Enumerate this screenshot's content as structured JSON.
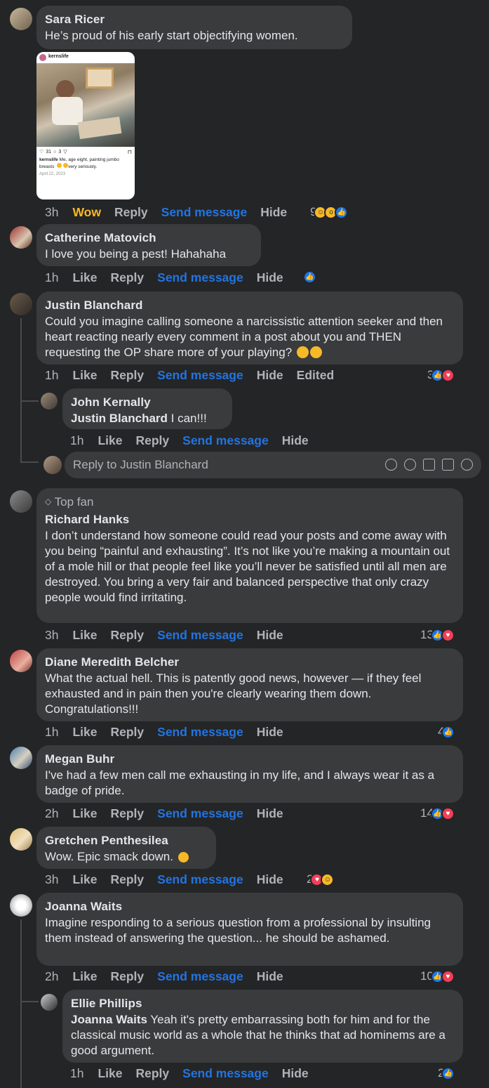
{
  "actions": {
    "like": "Like",
    "reply": "Reply",
    "send": "Send message",
    "hide": "Hide",
    "edited": "Edited",
    "wow": "Wow"
  },
  "comments": [
    {
      "name": "Sara Ricer",
      "text": "He’s proud of his early start objectifying women.",
      "time": "3h",
      "reaction_count": "9"
    },
    {
      "name": "Catherine Matovich",
      "text": "I love you being a pest! Hahahaha",
      "time": "1h"
    },
    {
      "name": "Justin Blanchard",
      "text": "Could you imagine calling someone a narcissistic attention seeker and then heart reacting nearly every comment in a post about you and THEN requesting the OP share more of your playing?",
      "time": "1h",
      "reaction_count": "3"
    },
    {
      "name": "Richard Hanks",
      "badge": "Top fan",
      "text": "I don’t understand how someone could read your posts and come away with you being “painful and exhausting”. It’s not like you’re making a mountain out of a mole hill or that people feel like you’ll never be satisfied until all men are destroyed. You bring a very fair and balanced perspective that only crazy people would find irritating.",
      "time": "3h",
      "reaction_count": "13"
    },
    {
      "name": "Diane Meredith Belcher",
      "text": "What the actual hell. This is patently good news, however — if they feel exhausted and in pain then you're clearly wearing them down. Congratulations!!!",
      "time": "1h",
      "reaction_count": "4"
    },
    {
      "name": "Megan Buhr",
      "text": "I've had a few men call me exhausting in my life, and I always wear it as a badge of pride.",
      "time": "2h",
      "reaction_count": "14"
    },
    {
      "name": "Gretchen Penthesilea",
      "text": "Wow. Epic smack down.",
      "time": "3h",
      "reaction_count": "2"
    },
    {
      "name": "Joanna Waits",
      "text": "Imagine responding to a serious question from a professional by insulting them instead of answering the question... he should be ashamed.",
      "time": "2h",
      "reaction_count": "10"
    }
  ],
  "replies": [
    {
      "name": "John Kernally",
      "mention": "Justin Blanchard",
      "text": " I can!!!",
      "time": "1h"
    },
    {
      "name": "Ellie Phillips",
      "mention": "Joanna Waits",
      "text": " Yeah it's pretty embarrassing both for him and for the classical music world as a whole that he thinks that ad hominems are a good argument.",
      "time": "1h",
      "reaction_count": "2"
    }
  ],
  "reply_box": {
    "placeholder": "Reply to Justin Blanchard"
  },
  "attachment": {
    "username": "kernslife",
    "likes": "31",
    "comments": "3",
    "caption_user": "kernslife",
    "caption": " Me, age eight, painting jumbo breasts",
    "caption_tail": "very seriously.",
    "date": "April 22, 2023"
  },
  "colors": {
    "background": "#242526",
    "bubble": "#3a3b3c",
    "link": "#2374e1",
    "wow": "#f7b928",
    "like": "#1877f2",
    "love": "#f33e58"
  }
}
